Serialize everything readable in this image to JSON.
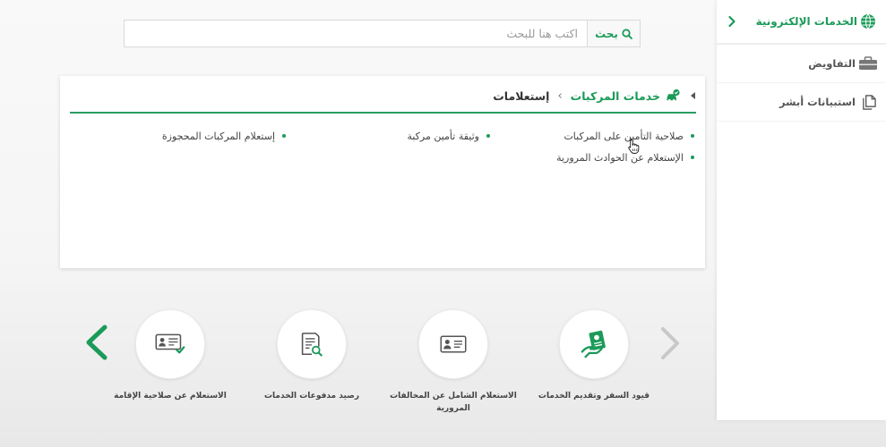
{
  "sidebar": {
    "header": {
      "label": "الخدمات الإلكترونية",
      "icon": "globe-icon"
    },
    "items": [
      {
        "label": "التفاويض",
        "icon": "briefcase-icon"
      },
      {
        "label": "استبيانات أبشر",
        "icon": "documents-icon"
      }
    ]
  },
  "search": {
    "placeholder": "اكتب هنا للبحث",
    "value": "",
    "button_label": "بحث",
    "icon": "search-icon"
  },
  "breadcrumb": {
    "icon": "car-check-icon",
    "section": "خدمات المركبات",
    "separator": "›",
    "current": "إستعلامات"
  },
  "links": {
    "columns": [
      [
        "صلاحية التأمين على المركبات",
        "الإستعلام عن الحوادث المرورية"
      ],
      [
        "وثيقة تأمين مركبة"
      ],
      [
        "إستعلام المركبات المحجوزة"
      ]
    ]
  },
  "carousel": {
    "items": [
      {
        "label_lines": [
          "قيود السفر وتقديم الخدمات"
        ],
        "icon": "passport-hand-icon"
      },
      {
        "label_lines": [
          "الاستعلام الشامل عن المخالفات",
          "المرورية"
        ],
        "icon": "id-card-icon"
      },
      {
        "label_lines": [
          "رصيد مدفوعات الخدمات"
        ],
        "icon": "receipt-search-icon"
      },
      {
        "label_lines": [
          "الاستعلام عن صلاحية الإقامة"
        ],
        "icon": "id-card-check-icon"
      }
    ],
    "prev_enabled": false,
    "next_enabled": true
  },
  "colors": {
    "primary_green": "#1b9a59",
    "text_dark": "#444444",
    "text_muted": "#9a9a9a",
    "disabled": "#c8c8c8"
  }
}
